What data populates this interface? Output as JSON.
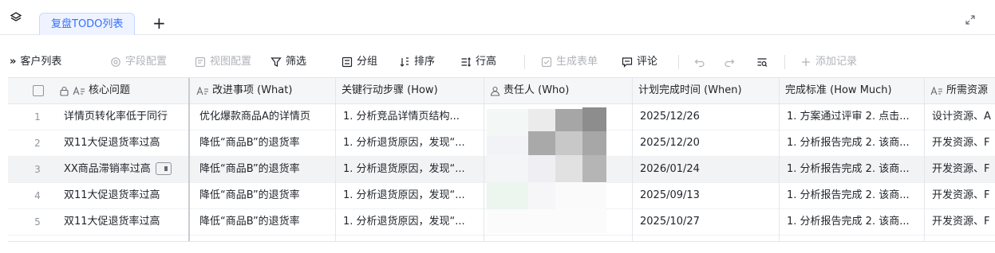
{
  "tabs": {
    "active": "复盘TODO列表",
    "add": "+"
  },
  "toolbar": {
    "view_toggle": "»",
    "view_name": "客户列表",
    "field_config": "字段配置",
    "view_config": "视图配置",
    "filter": "筛选",
    "group": "分组",
    "sort": "排序",
    "row_height": "行高",
    "generate_form": "生成表单",
    "comment": "评论",
    "add_record": "添加记录"
  },
  "table": {
    "columns": [
      {
        "label": "核心问题"
      },
      {
        "label": "改进事项 (What)"
      },
      {
        "label": "关键行动步骤 (How)"
      },
      {
        "label": "责任人 (Who)"
      },
      {
        "label": "计划完成时间 (When)"
      },
      {
        "label": "完成标准 (How Much)"
      },
      {
        "label": "所需资源"
      }
    ],
    "rows": [
      {
        "n": "1",
        "issue": "详情页转化率低于同行",
        "what": "优化爆款商品A的详情页",
        "how": "1. 分析竞品详情页结构...",
        "when": "2025/12/26",
        "std": "1. 方案通过评审 2. 点击...",
        "res": "设计资源、A"
      },
      {
        "n": "2",
        "issue": "双11大促退货率过高",
        "what": "降低“商品B”的退货率",
        "how": "1. 分析退货原因，发现“...",
        "when": "2025/12/20",
        "std": "1. 分析报告完成 2. 该商...",
        "res": "开发资源、F"
      },
      {
        "n": "3",
        "issue": "XX商品滞销率过高",
        "what": "降低“商品B”的退货率",
        "how": "1. 分析退货原因，发现“...",
        "when": "2026/01/24",
        "std": "1. 分析报告完成 2. 该商...",
        "res": "开发资源、F"
      },
      {
        "n": "4",
        "issue": "双11大促退货率过高",
        "what": "降低“商品B”的退货率",
        "how": "1. 分析退货原因，发现“...",
        "when": "2025/09/13",
        "std": "1. 分析报告完成 2. 该商...",
        "res": "开发资源、F"
      },
      {
        "n": "5",
        "issue": "双11大促退货率过高",
        "what": "降低“商品B”的退货率",
        "how": "1. 分析退货原因，发现“...",
        "when": "2025/10/27",
        "std": "1. 分析报告完成 2. 该商...",
        "res": "开发资源、F"
      }
    ]
  },
  "colors": {
    "accent": "#3370ff",
    "tab_bg": "#eef3ff"
  }
}
